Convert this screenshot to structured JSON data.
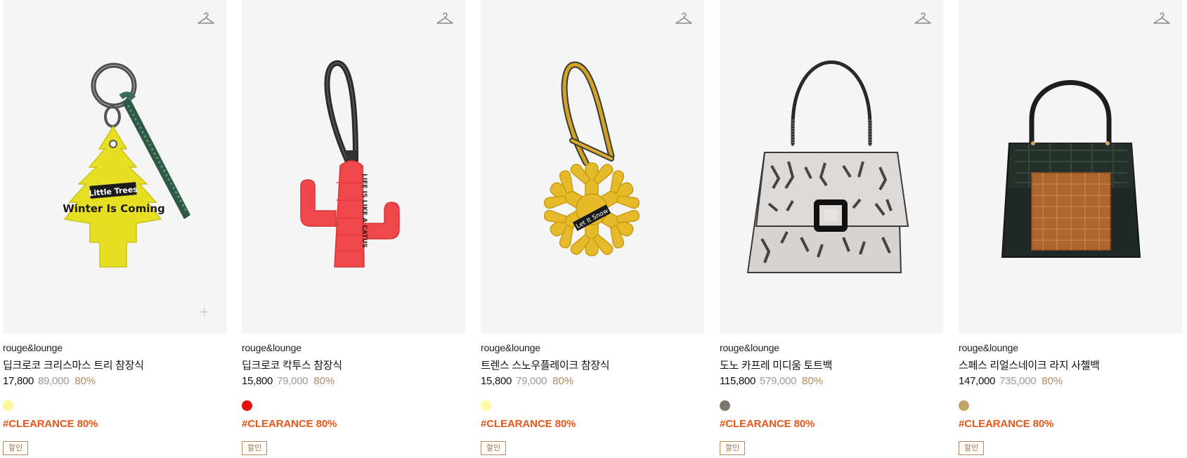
{
  "colors": {
    "accent_tag": "#e8561a",
    "discount_rate": "#b08a5e",
    "badge_border": "#b9875d",
    "thumb_bg": "#f5f5f5"
  },
  "products": [
    {
      "brand": "rouge&lounge",
      "name": "딥크로코 크리스마스 트리 참장식",
      "sale_price": "17,800",
      "original_price": "89,000",
      "discount": "80%",
      "swatch_color": "#fff59a",
      "tag": "#CLEARANCE 80%",
      "badge": "할인",
      "image_text_line1": "Little Trees",
      "image_text_line2": "Winter Is Coming",
      "icons": [
        "hanger-icon",
        "plus-icon"
      ]
    },
    {
      "brand": "rouge&lounge",
      "name": "딥크로코 칵투스 참장식",
      "sale_price": "15,800",
      "original_price": "79,000",
      "discount": "80%",
      "swatch_color": "#e60e0e",
      "tag": "#CLEARANCE 80%",
      "badge": "할인",
      "image_text_line1": "LIFE IS LIKE A CATUS",
      "icons": [
        "hanger-icon"
      ]
    },
    {
      "brand": "rouge&lounge",
      "name": "트렌스 스노우플레이크 참장식",
      "sale_price": "15,800",
      "original_price": "79,000",
      "discount": "80%",
      "swatch_color": "#fff8a6",
      "tag": "#CLEARANCE 80%",
      "badge": "할인",
      "image_text_line1": "Let It Snow",
      "icons": [
        "hanger-icon"
      ]
    },
    {
      "brand": "rouge&lounge",
      "name": "도노 카프레 미디움 토트백",
      "sale_price": "115,800",
      "original_price": "579,000",
      "discount": "80%",
      "swatch_color": "#7a786c",
      "tag": "#CLEARANCE 80%",
      "badge": "할인",
      "icons": [
        "hanger-icon"
      ]
    },
    {
      "brand": "rouge&lounge",
      "name": "스페스 리얼스네이크 라지 사첼백",
      "sale_price": "147,000",
      "original_price": "735,000",
      "discount": "80%",
      "swatch_color": "#c2a468",
      "tag": "#CLEARANCE 80%",
      "badge": "할인",
      "icons": [
        "hanger-icon"
      ]
    }
  ]
}
